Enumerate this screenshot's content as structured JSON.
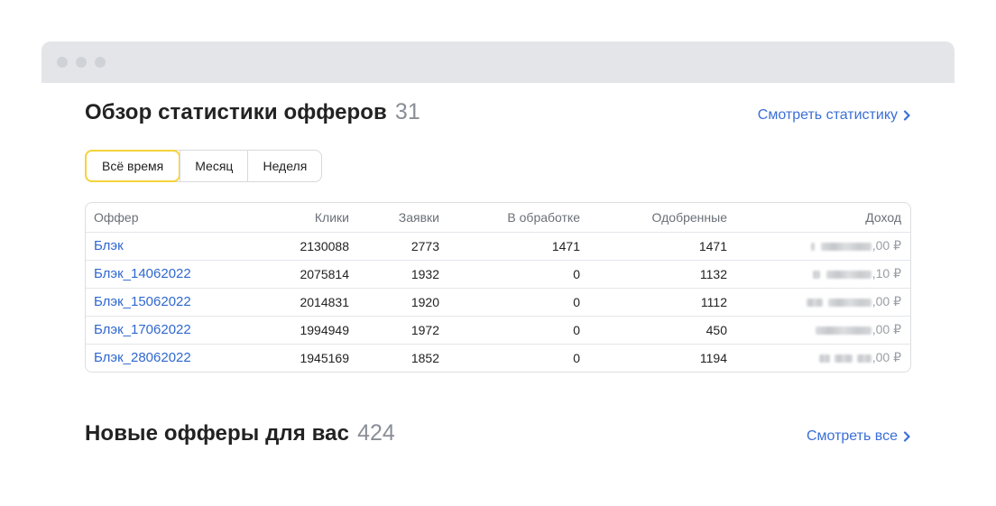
{
  "stats": {
    "title": "Обзор статистики офферов",
    "count": "31",
    "link": "Смотреть статистику",
    "tabs": [
      {
        "label": "Всё время",
        "active": true
      },
      {
        "label": "Месяц",
        "active": false
      },
      {
        "label": "Неделя",
        "active": false
      }
    ],
    "columns": {
      "offer": "Оффер",
      "clicks": "Клики",
      "requests": "Заявки",
      "processing": "В обработке",
      "approved": "Одобренные",
      "income": "Доход"
    },
    "rows": [
      {
        "offer": "Блэк",
        "clicks": "2130088",
        "requests": "2773",
        "processing": "1471",
        "approved": "1471",
        "income_suffix": ",00 ₽"
      },
      {
        "offer": "Блэк_14062022",
        "clicks": "2075814",
        "requests": "1932",
        "processing": "0",
        "approved": "1132",
        "income_suffix": ",10 ₽"
      },
      {
        "offer": "Блэк_15062022",
        "clicks": "2014831",
        "requests": "1920",
        "processing": "0",
        "approved": "1112",
        "income_suffix": ",00 ₽"
      },
      {
        "offer": "Блэк_17062022",
        "clicks": "1994949",
        "requests": "1972",
        "processing": "0",
        "approved": "450",
        "income_suffix": ",00 ₽"
      },
      {
        "offer": "Блэк_28062022",
        "clicks": "1945169",
        "requests": "1852",
        "processing": "0",
        "approved": "1194",
        "income_suffix": ",00 ₽"
      }
    ]
  },
  "new_offers": {
    "title": "Новые офферы для вас",
    "count": "424",
    "link": "Смотреть все"
  },
  "colors": {
    "accent_link": "#3b6fd6",
    "active_tab_border": "#f5d33b",
    "titlebar": "#e3e5e8"
  },
  "icons": {
    "link_chevron": "chevron-right-icon"
  }
}
